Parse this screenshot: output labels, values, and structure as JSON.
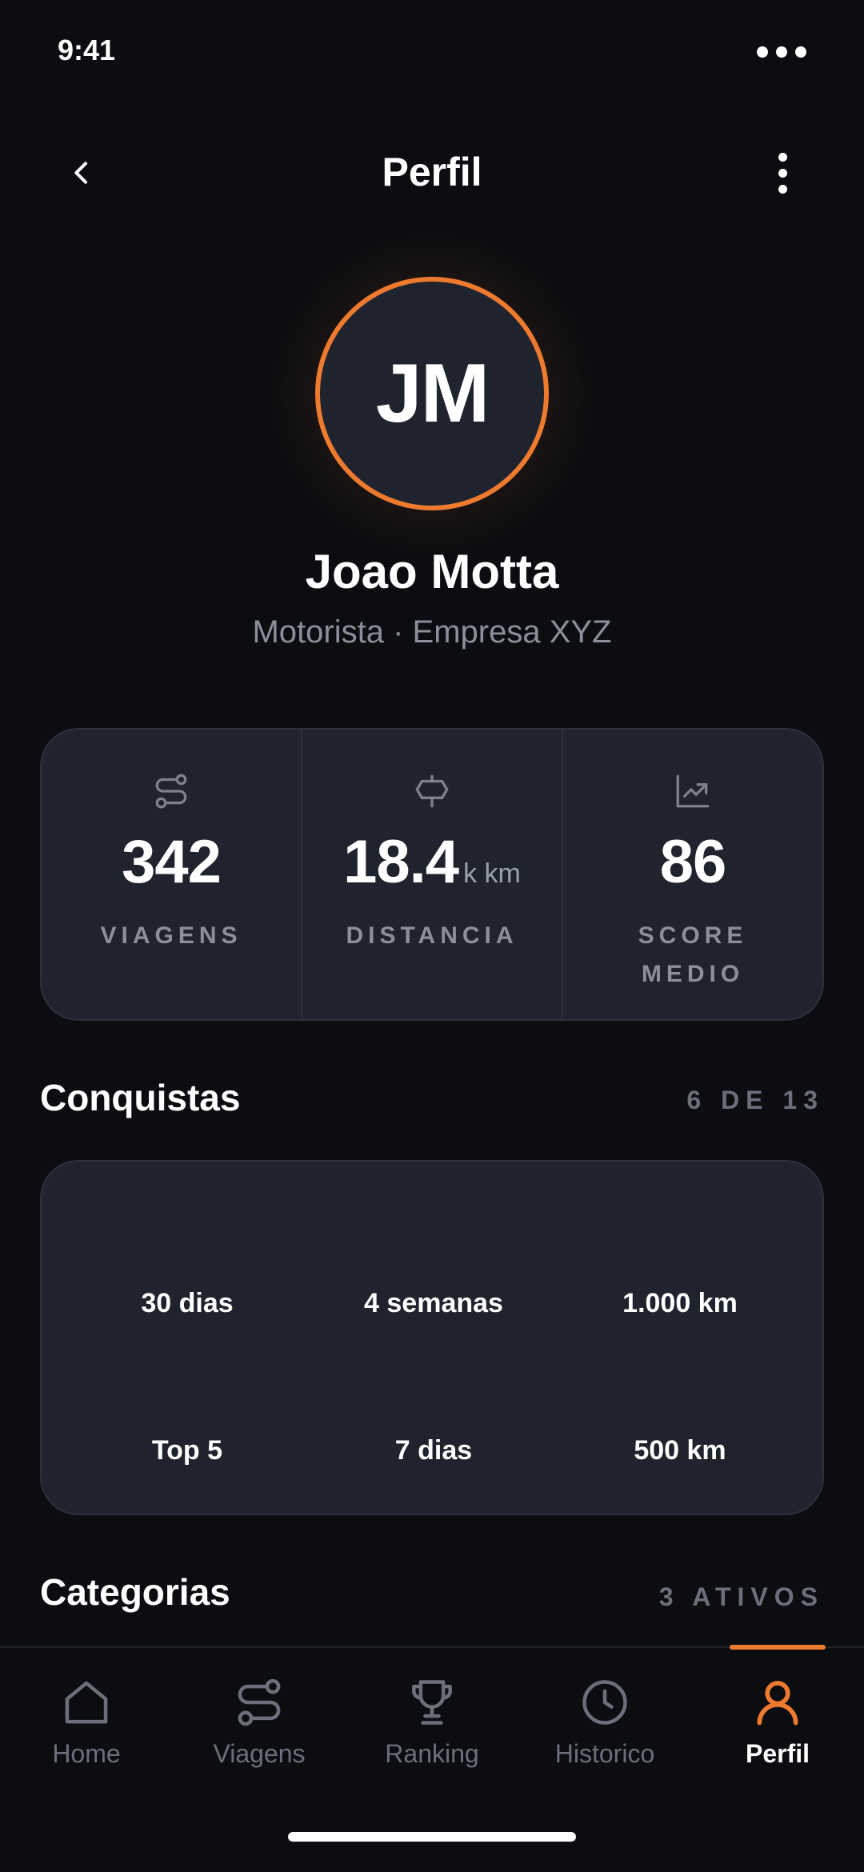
{
  "status_bar": {
    "time": "9:41"
  },
  "header": {
    "title": "Perfil"
  },
  "profile": {
    "initials": "JM",
    "name": "Joao Motta",
    "role": "Motorista · Empresa XYZ",
    "accent_color": "#ee7a2f"
  },
  "stats": [
    {
      "icon": "route-icon",
      "value": "342",
      "unit": "",
      "label": "VIAGENS"
    },
    {
      "icon": "signpost-icon",
      "value": "18.4",
      "unit": "k km",
      "label": "DISTANCIA"
    },
    {
      "icon": "trending-chart-icon",
      "value": "86",
      "unit": "",
      "label": "SCORE MEDIO"
    }
  ],
  "achievements": {
    "title": "Conquistas",
    "count": "6 DE 13",
    "items": [
      "30 dias",
      "4 semanas",
      "1.000 km",
      "Top 5",
      "7 dias",
      "500 km"
    ]
  },
  "categories": {
    "title": "Categorias",
    "count": "3 ATIVOS"
  },
  "nav": [
    {
      "label": "Home",
      "icon": "home-icon",
      "active": false
    },
    {
      "label": "Viagens",
      "icon": "route-icon",
      "active": false
    },
    {
      "label": "Ranking",
      "icon": "trophy-icon",
      "active": false
    },
    {
      "label": "Historico",
      "icon": "clock-icon",
      "active": false
    },
    {
      "label": "Perfil",
      "icon": "user-icon",
      "active": true
    }
  ]
}
